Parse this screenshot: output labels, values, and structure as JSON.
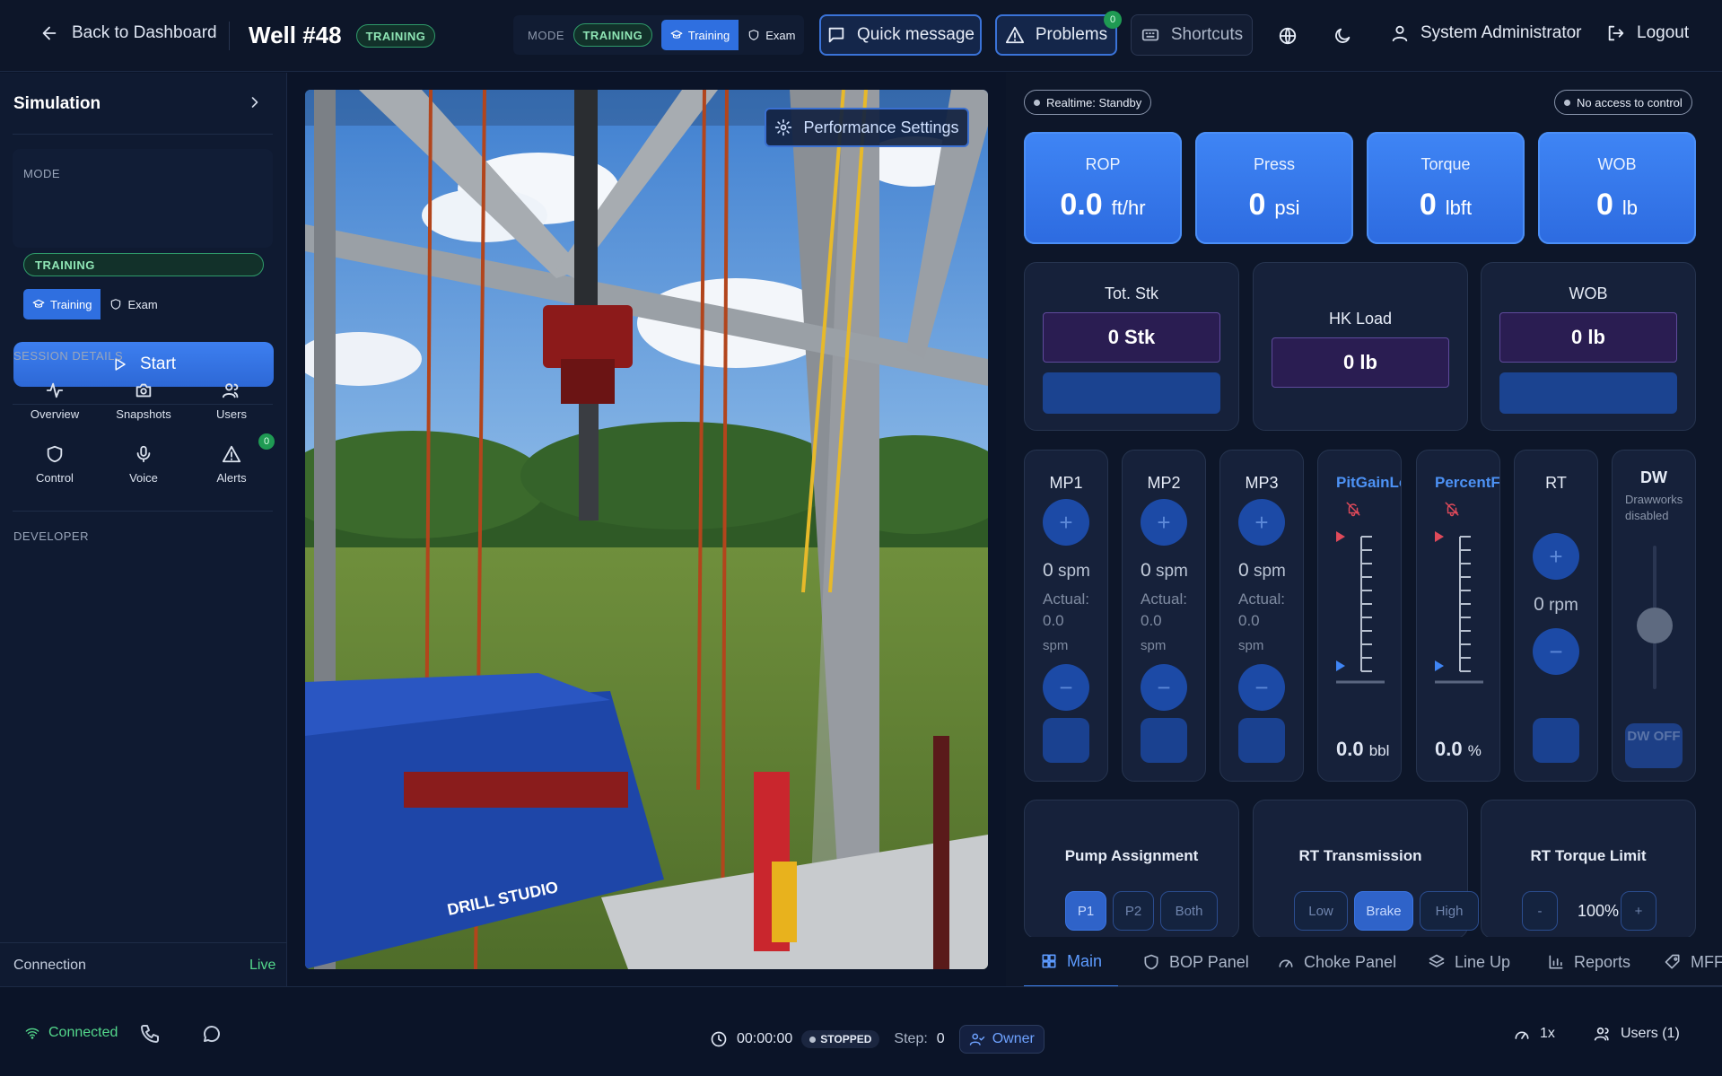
{
  "header": {
    "back_label": "Back to Dashboard",
    "well_title": "Well #48",
    "well_mode_badge": "TRAINING",
    "mode_label": "MODE",
    "mode_badge": "TRAINING",
    "mode_training": "Training",
    "mode_exam": "Exam",
    "quick_message": "Quick message",
    "problems": "Problems",
    "problems_count": "0",
    "shortcuts": "Shortcuts",
    "user_name": "System Administrator",
    "logout": "Logout"
  },
  "sidebar": {
    "title": "Simulation",
    "mode_label": "MODE",
    "mode_badge": "TRAINING",
    "mode_training": "Training",
    "mode_exam": "Exam",
    "start": "Start",
    "session_details_label": "SESSION DETAILS",
    "items": [
      {
        "label": "Overview",
        "icon": "activity-icon"
      },
      {
        "label": "Snapshots",
        "icon": "camera-icon"
      },
      {
        "label": "Users",
        "icon": "users-icon"
      },
      {
        "label": "Control",
        "icon": "shield-icon"
      },
      {
        "label": "Voice",
        "icon": "microphone-icon"
      },
      {
        "label": "Alerts",
        "icon": "alert-triangle-icon"
      }
    ],
    "alerts_count": "0",
    "developer_label": "DEVELOPER",
    "connection_label": "Connection",
    "connection_value": "Live"
  },
  "viewport": {
    "performance_settings": "Performance Settings",
    "scene_text": "DRILL STUDIO"
  },
  "panel": {
    "realtime_status": "Realtime: Standby",
    "access_status": "No access to control",
    "kpis": [
      {
        "name": "ROP",
        "value": "0.0",
        "unit": "ft/hr"
      },
      {
        "name": "Press",
        "value": "0",
        "unit": "psi"
      },
      {
        "name": "Torque",
        "value": "0",
        "unit": "lbft"
      },
      {
        "name": "WOB",
        "value": "0",
        "unit": "lb"
      }
    ],
    "tot_stk": {
      "title": "Tot. Stk",
      "value": "0 Stk"
    },
    "hk_load": {
      "title": "HK Load",
      "value": "0 lb"
    },
    "wob": {
      "title": "WOB",
      "value": "0 lb"
    },
    "mp1": {
      "title": "MP1",
      "value": "0",
      "unit": "spm",
      "actual_label": "Actual:",
      "actual_value": "0.0",
      "actual_unit": "spm"
    },
    "mp2": {
      "title": "MP2",
      "value": "0",
      "unit": "spm",
      "actual_label": "Actual:",
      "actual_value": "0.0",
      "actual_unit": "spm"
    },
    "mp3": {
      "title": "MP3",
      "value": "0",
      "unit": "spm",
      "actual_label": "Actual:",
      "actual_value": "0.0",
      "actual_unit": "spm"
    },
    "pit_gain_loss": {
      "title": "PitGainLoss",
      "value": "0.0",
      "unit": "bbl"
    },
    "percent_flow": {
      "title": "PercentFlow",
      "value": "0.0",
      "unit": "%"
    },
    "rt": {
      "title": "RT",
      "value": "0",
      "unit": "rpm"
    },
    "dw": {
      "title": "DW",
      "note": "Drawworks disabled",
      "button": "DW OFF"
    },
    "pump_assignment": {
      "title": "Pump Assignment",
      "options": [
        "P1",
        "P2",
        "Both"
      ],
      "selected": "P1"
    },
    "rt_transmission": {
      "title": "RT Transmission",
      "options": [
        "Low",
        "Brake",
        "High"
      ],
      "selected": "Brake"
    },
    "rt_torque_limit": {
      "title": "RT Torque Limit",
      "minus": "-",
      "value": "100%",
      "plus": "+"
    },
    "tabs": [
      "Main",
      "BOP Panel",
      "Choke Panel",
      "Line Up",
      "Reports",
      "MFFI"
    ]
  },
  "status": {
    "connected": "Connected",
    "timer": "00:00:00",
    "state": "STOPPED",
    "step_label": "Step:",
    "step_value": "0",
    "role": "Owner",
    "speed": "1x",
    "users": "Users (1)"
  },
  "colors": {
    "accent": "#3f85f5",
    "live": "#54d98c",
    "background": "#0b1428"
  }
}
